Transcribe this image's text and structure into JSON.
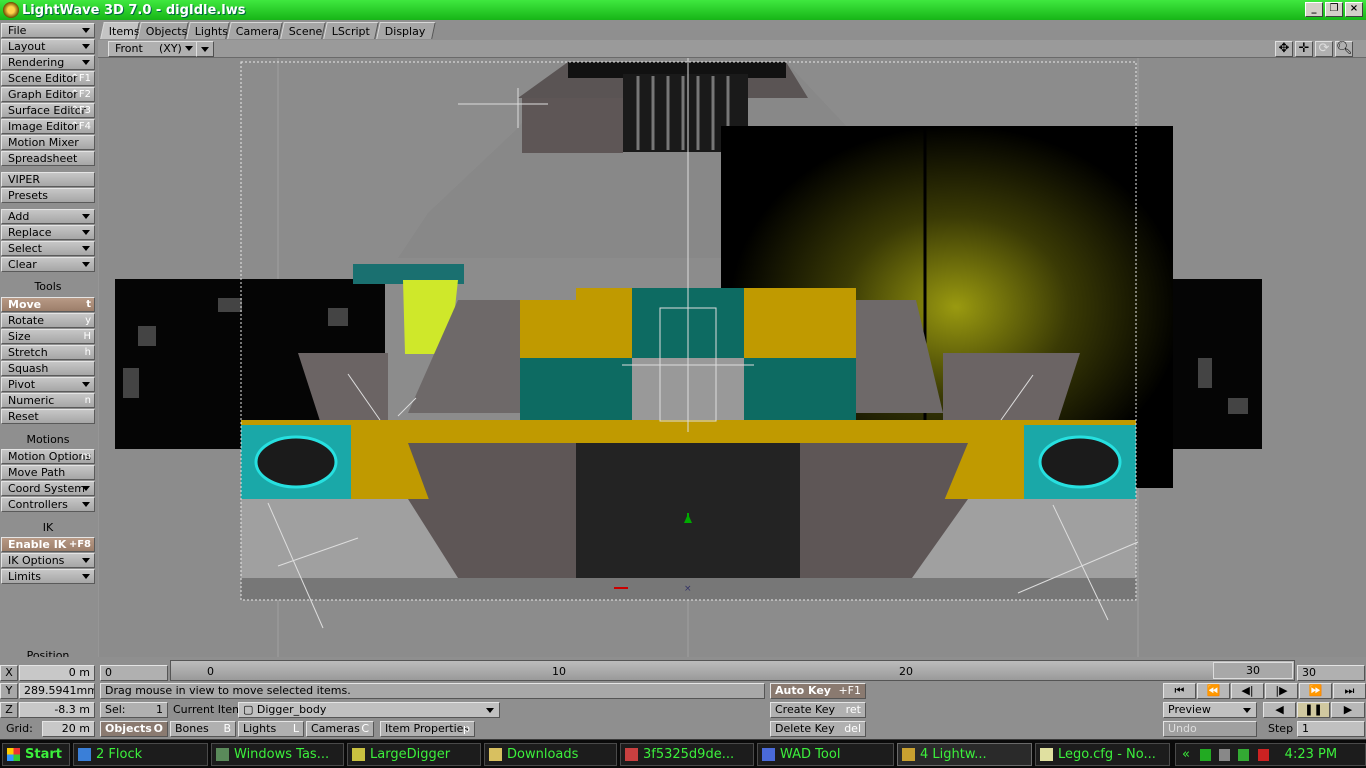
{
  "window": {
    "title": "LightWave 3D 7.0 - digIdle.lws"
  },
  "left_panel": {
    "menus": [
      {
        "label": "File",
        "shortcut": "",
        "dropdown": true
      },
      {
        "label": "Layout",
        "shortcut": "",
        "dropdown": true
      },
      {
        "label": "Rendering",
        "shortcut": "",
        "dropdown": true
      },
      {
        "label": "Scene Editor",
        "shortcut": "^F1",
        "dropdown": false
      },
      {
        "label": "Graph Editor",
        "shortcut": "^F2",
        "dropdown": false
      },
      {
        "label": "Surface Editor",
        "shortcut": "^F3",
        "dropdown": false
      },
      {
        "label": "Image Editor",
        "shortcut": "^F4",
        "dropdown": false
      },
      {
        "label": "Motion Mixer",
        "shortcut": "",
        "dropdown": false
      },
      {
        "label": "Spreadsheet",
        "shortcut": "",
        "dropdown": false
      }
    ],
    "viper": "VIPER",
    "presets": "Presets",
    "edit": [
      {
        "label": "Add",
        "dropdown": true
      },
      {
        "label": "Replace",
        "dropdown": true
      },
      {
        "label": "Select",
        "dropdown": true
      },
      {
        "label": "Clear",
        "dropdown": true
      }
    ],
    "tools_heading": "Tools",
    "tools": [
      {
        "label": "Move",
        "shortcut": "t",
        "dropdown": false,
        "active": true
      },
      {
        "label": "Rotate",
        "shortcut": "y",
        "dropdown": false
      },
      {
        "label": "Size",
        "shortcut": "H",
        "dropdown": false
      },
      {
        "label": "Stretch",
        "shortcut": "h",
        "dropdown": false
      },
      {
        "label": "Squash",
        "shortcut": "",
        "dropdown": false
      },
      {
        "label": "Pivot",
        "shortcut": "",
        "dropdown": true
      },
      {
        "label": "Numeric",
        "shortcut": "n",
        "dropdown": false
      },
      {
        "label": "Reset",
        "shortcut": "",
        "dropdown": false
      }
    ],
    "motions_heading": "Motions",
    "motions": [
      {
        "label": "Motion Options",
        "shortcut": "m",
        "dropdown": false
      },
      {
        "label": "Move Path",
        "shortcut": "",
        "dropdown": false
      },
      {
        "label": "Coord System",
        "shortcut": "",
        "dropdown": true
      },
      {
        "label": "Controllers",
        "shortcut": "",
        "dropdown": true
      }
    ],
    "ik_heading": "IK",
    "ik": [
      {
        "label": "Enable IK",
        "shortcut": "+F8",
        "dropdown": false,
        "active": true
      },
      {
        "label": "IK Options",
        "shortcut": "",
        "dropdown": true
      },
      {
        "label": "Limits",
        "shortcut": "",
        "dropdown": true
      }
    ],
    "position_label": "Position"
  },
  "tabs": [
    "Items",
    "Objects",
    "Lights",
    "Camera",
    "Scene",
    "LScript",
    "Display"
  ],
  "view": {
    "mode": "Front",
    "axes": "(XY)"
  },
  "coords": {
    "x_label": "X",
    "x_value": "0 m",
    "y_label": "Y",
    "y_value": "289.5941mm",
    "z_label": "Z",
    "z_value": "-8.3 m",
    "grid_label": "Grid:",
    "grid_value": "20 m"
  },
  "timeline": {
    "start": "0",
    "ticks": [
      "0",
      "10",
      "20",
      "30"
    ],
    "current_frame": "30",
    "end": "30"
  },
  "status": "Drag mouse in view to move selected items.",
  "sel": {
    "label": "Sel:",
    "value": "1"
  },
  "current_item": {
    "label": "Current Item",
    "value": "Digger_body"
  },
  "item_types": [
    {
      "label": "Objects",
      "key": "O",
      "active": true
    },
    {
      "label": "Bones",
      "key": "B"
    },
    {
      "label": "Lights",
      "key": "L"
    },
    {
      "label": "Cameras",
      "key": "C"
    }
  ],
  "item_properties": {
    "label": "Item Properties",
    "key": "p"
  },
  "keys": {
    "auto": "Auto Key",
    "auto_sc": "+F1",
    "create": "Create Key",
    "create_sc": "ret",
    "delete": "Delete Key",
    "delete_sc": "del"
  },
  "playback": {
    "preview": "Preview",
    "undo": "Undo",
    "step_label": "Step",
    "step_value": "1"
  },
  "taskbar": {
    "start": "Start",
    "items": [
      "2 Flock",
      "Windows Tas...",
      "LargeDigger",
      "Downloads",
      "3f5325d9de...",
      "WAD Tool",
      "4 Lightw...",
      "Lego.cfg - No..."
    ],
    "clock": "4:23 PM"
  },
  "colors": {
    "title_green": "#1fc41f",
    "active_tool": "#a8897a",
    "taskbar_text": "#3cf03c"
  }
}
